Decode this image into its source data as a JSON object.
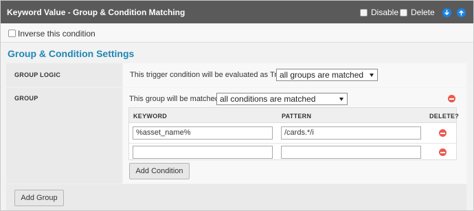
{
  "header": {
    "title": "Keyword Value - Group & Condition Matching",
    "disable_label": "Disable",
    "delete_label": "Delete",
    "bg_color": "#5a5a5a",
    "arrow_color": "#1a84e6"
  },
  "inverse": {
    "label": "Inverse this condition",
    "checked": false
  },
  "section": {
    "title": "Group & Condition Settings",
    "color": "#1e86b4"
  },
  "group_logic": {
    "label": "GROUP LOGIC",
    "sentence": "This trigger condition will be evaluated as True if",
    "selected": "all groups are matched"
  },
  "group": {
    "label": "GROUP",
    "sentence": "This group will be matched if",
    "selected": "all conditions are matched",
    "columns": {
      "keyword": "KEYWORD",
      "pattern": "PATTERN",
      "delete": "DELETE?"
    },
    "conditions": [
      {
        "keyword": "%asset_name%",
        "pattern": "/cards.*/i"
      },
      {
        "keyword": "",
        "pattern": ""
      }
    ],
    "add_condition_label": "Add Condition"
  },
  "add_group_label": "Add Group",
  "delete_color": "#ea5a52"
}
